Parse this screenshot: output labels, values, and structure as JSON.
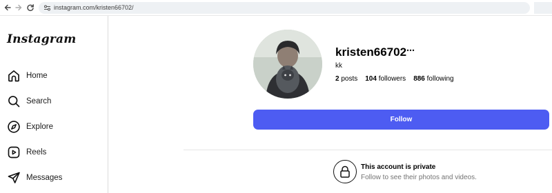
{
  "browser": {
    "url": "instagram.com/kristen66702/"
  },
  "sidebar": {
    "logo": "Instagram",
    "items": [
      {
        "label": "Home",
        "icon": "home-icon"
      },
      {
        "label": "Search",
        "icon": "search-icon"
      },
      {
        "label": "Explore",
        "icon": "explore-icon"
      },
      {
        "label": "Reels",
        "icon": "reels-icon"
      },
      {
        "label": "Messages",
        "icon": "messages-icon"
      }
    ]
  },
  "profile": {
    "username": "kristen66702",
    "display_name": "kk",
    "stats": [
      {
        "count": "2",
        "label": "posts"
      },
      {
        "count": "104",
        "label": "followers"
      },
      {
        "count": "886",
        "label": "following"
      }
    ],
    "follow_label": "Follow"
  },
  "private_notice": {
    "title": "This account is private",
    "subtitle": "Follow to see their photos and videos."
  },
  "colors": {
    "follow_button": "#4d5cf2",
    "muted_text": "#737373"
  }
}
